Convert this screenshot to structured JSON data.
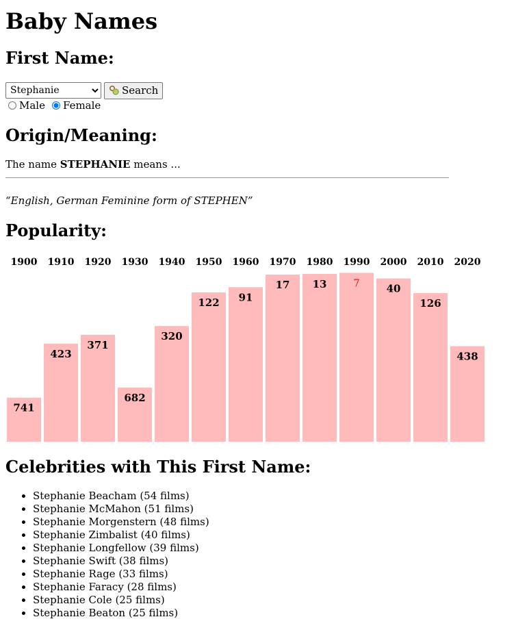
{
  "page": {
    "title": "Baby Names"
  },
  "first_name": {
    "heading": "First Name:",
    "selected": "Stephanie",
    "search_label": "Search",
    "gender": {
      "male_label": "Male",
      "female_label": "Female",
      "selected": "Female"
    }
  },
  "origin": {
    "heading": "Origin/Meaning:",
    "prefix": "The name ",
    "name_upper": "STEPHANIE",
    "suffix": " means ...",
    "meaning": "“English, German Feminine form of STEPHEN”"
  },
  "popularity": {
    "heading": "Popularity:"
  },
  "chart_data": {
    "type": "bar",
    "categories": [
      "1900",
      "1910",
      "1920",
      "1930",
      "1940",
      "1950",
      "1960",
      "1970",
      "1980",
      "1990",
      "2000",
      "2010",
      "2020"
    ],
    "values": [
      741,
      423,
      371,
      682,
      320,
      122,
      91,
      17,
      13,
      7,
      40,
      126,
      438
    ],
    "best_rank_highlight": "1990",
    "colors": {
      "bar": "#ffbbbb",
      "label": "#000000",
      "highlight_label": "#dd2222"
    }
  },
  "celebrities": {
    "heading": "Celebrities with This First Name:",
    "items": [
      "Stephanie Beacham (54 films)",
      "Stephanie McMahon (51 films)",
      "Stephanie Morgenstern (48 films)",
      "Stephanie Zimbalist (40 films)",
      "Stephanie Longfellow (39 films)",
      "Stephanie Swift (38 films)",
      "Stephanie Rage (33 films)",
      "Stephanie Faracy (28 films)",
      "Stephanie Cole (25 films)",
      "Stephanie Beaton (25 films)"
    ]
  }
}
